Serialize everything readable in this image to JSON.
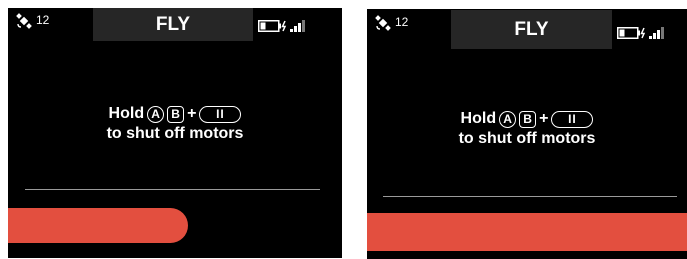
{
  "accent_color": "#e34f3f",
  "screens": [
    {
      "title": "FLY",
      "satellite_count": "12",
      "satellite_icon": "satellite-icon",
      "battery_icon": "battery-charging-icon",
      "signal_icon": "signal-strength-icon",
      "message_line1_prefix": "Hold",
      "button_a": "A",
      "button_b": "B",
      "plus": "+",
      "button_pause": "II",
      "message_line2": "to shut off motors",
      "hold_progress": 0.54
    },
    {
      "title": "FLY",
      "satellite_count": "12",
      "satellite_icon": "satellite-icon",
      "battery_icon": "battery-charging-icon",
      "signal_icon": "signal-strength-icon",
      "message_line1_prefix": "Hold",
      "button_a": "A",
      "button_b": "B",
      "plus": "+",
      "button_pause": "II",
      "message_line2": "to shut off motors",
      "hold_progress": 1.0
    }
  ]
}
